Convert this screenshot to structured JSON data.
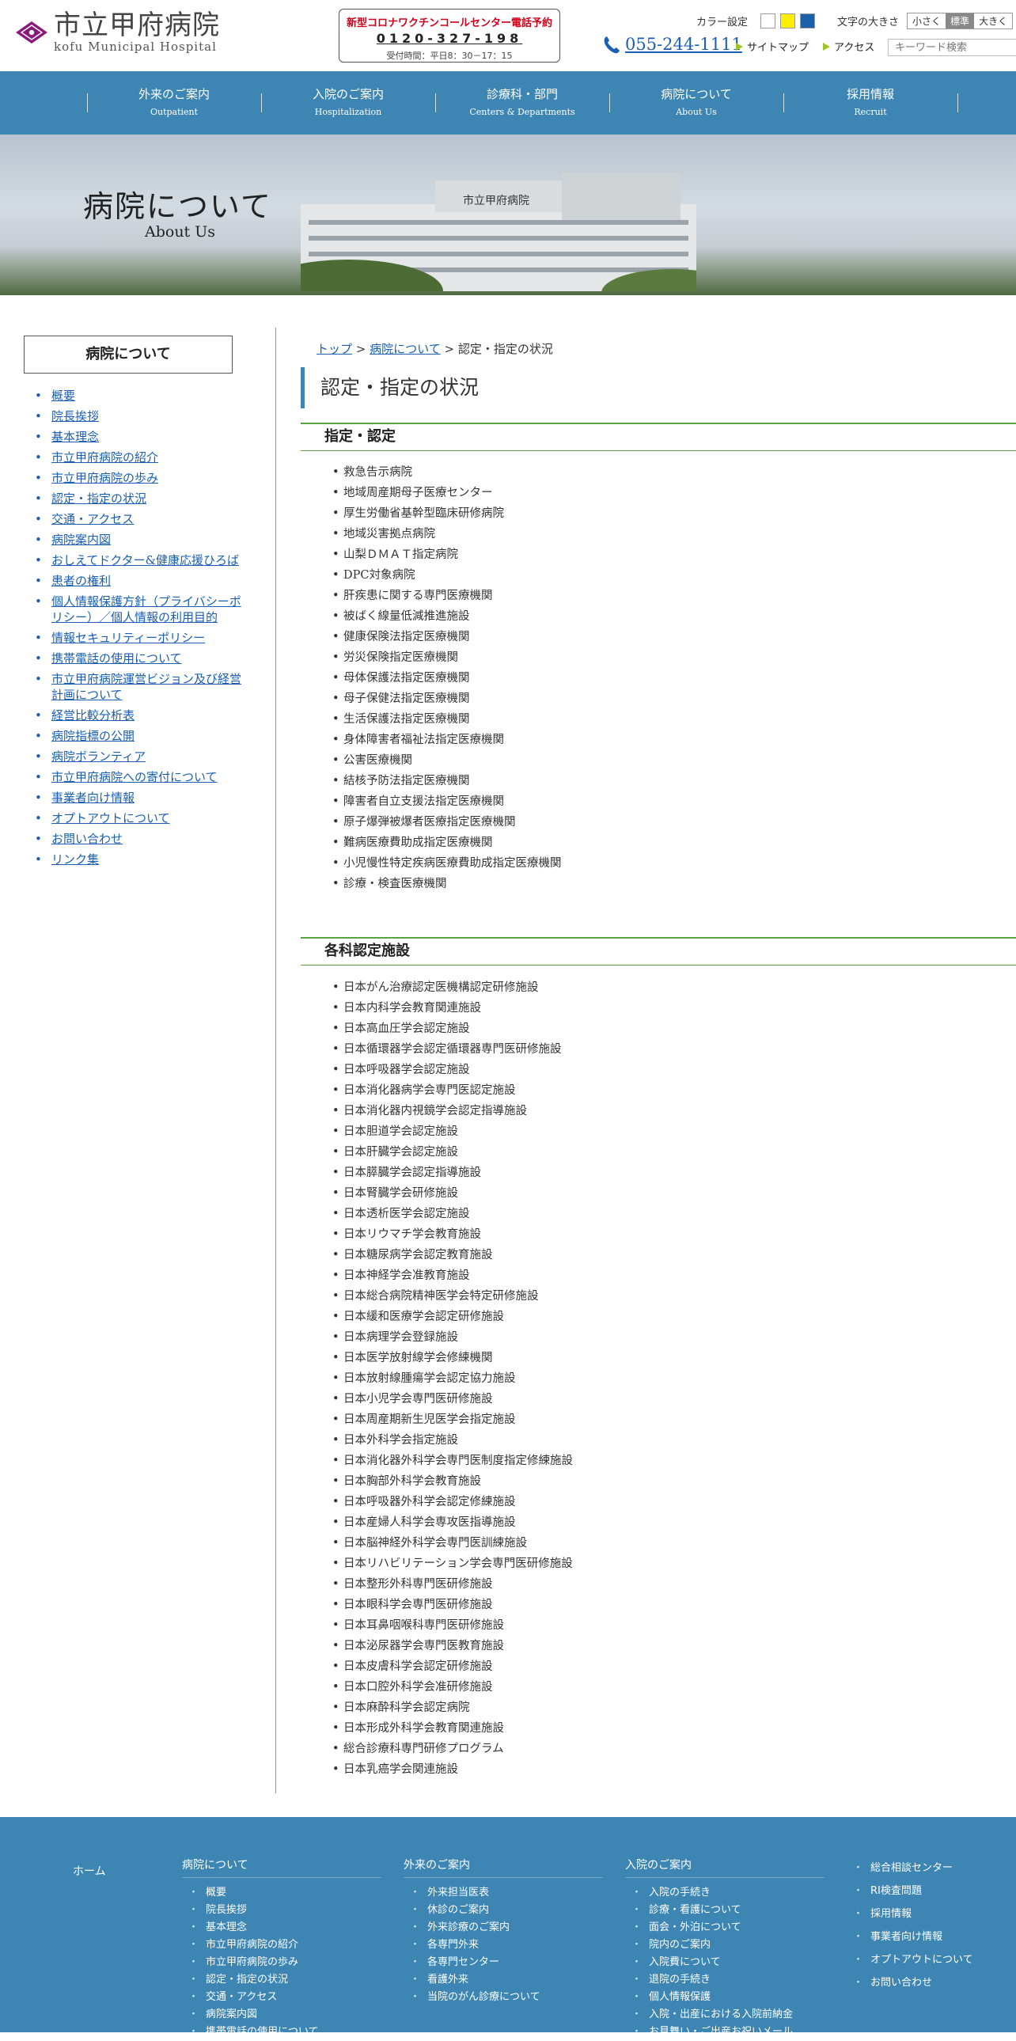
{
  "header": {
    "logo_jp": "市立甲府病院",
    "logo_en": "kofu Municipal Hospital",
    "covid_title": "新型コロナワクチンコールセンター電話予約",
    "covid_tel": "0120-327-198",
    "covid_hours": "受付時間：平日8：30－17：15",
    "color_label": "カラー設定",
    "color_swatches": [
      "#ffffff",
      "#ffee00",
      "#1d5fa8"
    ],
    "font_size_label": "文字の大きさ",
    "font_sizes": [
      "小さく",
      "標準",
      "大きく"
    ],
    "phone": "055-244-1111",
    "sitemap": "サイトマップ",
    "access": "アクセス",
    "search_placeholder": "キーワード検索"
  },
  "nav": [
    {
      "jp": "外来のご案内",
      "en": "Outpatient"
    },
    {
      "jp": "入院のご案内",
      "en": "Hospitalization"
    },
    {
      "jp": "診療科・部門",
      "en": "Centers & Departments"
    },
    {
      "jp": "病院について",
      "en": "About Us"
    },
    {
      "jp": "採用情報",
      "en": "Recruit"
    }
  ],
  "hero": {
    "title": "病院について",
    "subtitle": "About Us",
    "building_sign": "市立甲府病院"
  },
  "sidebar": {
    "title": "病院について",
    "items": [
      "概要",
      "院長挨拶",
      "基本理念",
      "市立甲府病院の紹介",
      "市立甲府病院の歩み",
      "認定・指定の状況",
      "交通・アクセス",
      "病院案内図",
      "おしえてドクター&健康応援ひろば",
      "患者の権利",
      "個人情報保護方針（プライバシーポリシー）／個人情報の利用目的",
      "情報セキュリティーポリシー",
      "携帯電話の使用について",
      "市立甲府病院運営ビジョン及び経営計画について",
      "経営比較分析表",
      "病院指標の公開",
      "病院ボランティア",
      "市立甲府病院への寄付について",
      "事業者向け情報",
      "オプトアウトについて",
      "お問い合わせ",
      "リンク集"
    ]
  },
  "breadcrumb": {
    "top": "トップ",
    "parent": "病院について",
    "sep": ">",
    "current": "認定・指定の状況"
  },
  "main": {
    "title": "認定・指定の状況",
    "sections": [
      {
        "heading": "指定・認定",
        "items": [
          "救急告示病院",
          "地域周産期母子医療センター",
          "厚生労働省基幹型臨床研修病院",
          "地域災害拠点病院",
          "山梨ＤＭＡＴ指定病院",
          "DPC対象病院",
          "肝疾患に関する専門医療機関",
          "被ばく線量低減推進施設",
          "健康保険法指定医療機関",
          "労災保険指定医療機関",
          "母体保護法指定医療機関",
          "母子保健法指定医療機関",
          "生活保護法指定医療機関",
          "身体障害者福祉法指定医療機関",
          "公害医療機関",
          "結核予防法指定医療機関",
          "障害者自立支援法指定医療機関",
          "原子爆弾被爆者医療指定医療機関",
          "難病医療費助成指定医療機関",
          "小児慢性特定疾病医療費助成指定医療機関",
          "診療・検査医療機関"
        ]
      },
      {
        "heading": "各科認定施設",
        "items": [
          "日本がん治療認定医機構認定研修施設",
          "日本内科学会教育関連施設",
          "日本高血圧学会認定施設",
          "日本循環器学会認定循環器専門医研修施設",
          "日本呼吸器学会認定施設",
          "日本消化器病学会専門医認定施設",
          "日本消化器内視鏡学会認定指導施設",
          "日本胆道学会認定施設",
          "日本肝臓学会認定施設",
          "日本膵臓学会認定指導施設",
          "日本腎臓学会研修施設",
          "日本透析医学会認定施設",
          "日本リウマチ学会教育施設",
          "日本糖尿病学会認定教育施設",
          "日本神経学会准教育施設",
          "日本総合病院精神医学会特定研修施設",
          "日本緩和医療学会認定研修施設",
          "日本病理学会登録施設",
          "日本医学放射線学会修練機関",
          "日本放射線腫瘍学会認定協力施設",
          "日本小児学会専門医研修施設",
          "日本周産期新生児医学会指定施設",
          "日本外科学会指定施設",
          "日本消化器外科学会専門医制度指定修練施設",
          "日本胸部外科学会教育施設",
          "日本呼吸器外科学会認定修練施設",
          "日本産婦人科学会専攻医指導施設",
          "日本脳神経外科学会専門医訓練施設",
          "日本リハビリテーション学会専門医研修施設",
          "日本整形外科専門医研修施設",
          "日本眼科学会専門医研修施設",
          "日本耳鼻咽喉科専門医研修施設",
          "日本泌尿器学会専門医教育施設",
          "日本皮膚科学会認定研修施設",
          "日本口腔外科学会准研修施設",
          "日本麻酔科学会認定病院",
          "日本形成外科学会教育関連施設",
          "総合診療科専門研修プログラム",
          "日本乳癌学会関連施設"
        ]
      }
    ]
  },
  "footer": {
    "home": "ホーム",
    "columns": [
      {
        "title": "病院について",
        "items": [
          "概要",
          "院長挨拶",
          "基本理念",
          "市立甲府病院の紹介",
          "市立甲府病院の歩み",
          "認定・指定の状況",
          "交通・アクセス",
          "病院案内図",
          "携帯電話の使用について"
        ]
      },
      {
        "title": "外来のご案内",
        "items": [
          "外来担当医表",
          "休診のご案内",
          "外来診療のご案内",
          "各専門外来",
          "各専門センター",
          "看護外来",
          "当院のがん診療について"
        ]
      },
      {
        "title": "入院のご案内",
        "items": [
          "入院の手続き",
          "診療・看護について",
          "面会・外泊について",
          "院内のご案内",
          "入院費について",
          "退院の手続き",
          "個人情報保護",
          "入院・出産における入院前納金",
          "お見舞い・ご出産お祝いメール"
        ]
      }
    ],
    "right": [
      "総合相談センター",
      "RI検査問題",
      "採用情報",
      "事業者向け情報",
      "オプトアウトについて",
      "お問い合わせ"
    ]
  }
}
